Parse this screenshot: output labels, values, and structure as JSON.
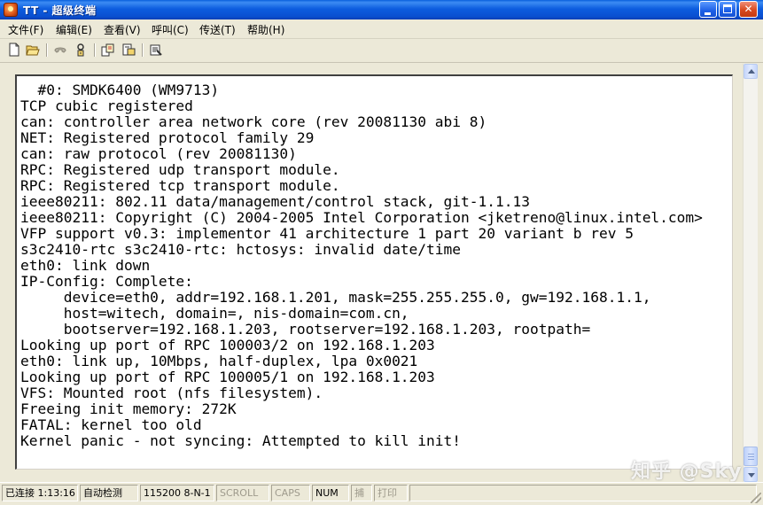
{
  "window": {
    "title": "TT - 超级终端"
  },
  "menu": {
    "items": [
      "文件(F)",
      "编辑(E)",
      "查看(V)",
      "呼叫(C)",
      "传送(T)",
      "帮助(H)"
    ]
  },
  "toolbar": {
    "icons": [
      "new-icon",
      "open-icon",
      "dial-icon",
      "disconnect-icon",
      "send-icon",
      "receive-icon",
      "properties-icon"
    ]
  },
  "terminal": {
    "lines": [
      "  #0: SMDK6400 (WM9713)",
      "TCP cubic registered",
      "can: controller area network core (rev 20081130 abi 8)",
      "NET: Registered protocol family 29",
      "can: raw protocol (rev 20081130)",
      "RPC: Registered udp transport module.",
      "RPC: Registered tcp transport module.",
      "ieee80211: 802.11 data/management/control stack, git-1.1.13",
      "ieee80211: Copyright (C) 2004-2005 Intel Corporation <jketreno@linux.intel.com>",
      "VFP support v0.3: implementor 41 architecture 1 part 20 variant b rev 5",
      "s3c2410-rtc s3c2410-rtc: hctosys: invalid date/time",
      "eth0: link down",
      "IP-Config: Complete:",
      "     device=eth0, addr=192.168.1.201, mask=255.255.255.0, gw=192.168.1.1,",
      "     host=witech, domain=, nis-domain=com.cn,",
      "     bootserver=192.168.1.203, rootserver=192.168.1.203, rootpath=",
      "Looking up port of RPC 100003/2 on 192.168.1.203",
      "eth0: link up, 10Mbps, half-duplex, lpa 0x0021",
      "Looking up port of RPC 100005/1 on 192.168.1.203",
      "VFS: Mounted root (nfs filesystem).",
      "Freeing init memory: 272K",
      "FATAL: kernel too old",
      "Kernel panic - not syncing: Attempted to kill init!"
    ]
  },
  "watermark": "知乎 @Sky",
  "status": {
    "connected": "已连接 1:13:16",
    "detect": "自动检测",
    "port": "115200 8-N-1",
    "scroll": "SCROLL",
    "caps": "CAPS",
    "num": "NUM",
    "capture": "捕",
    "print": "打印"
  }
}
